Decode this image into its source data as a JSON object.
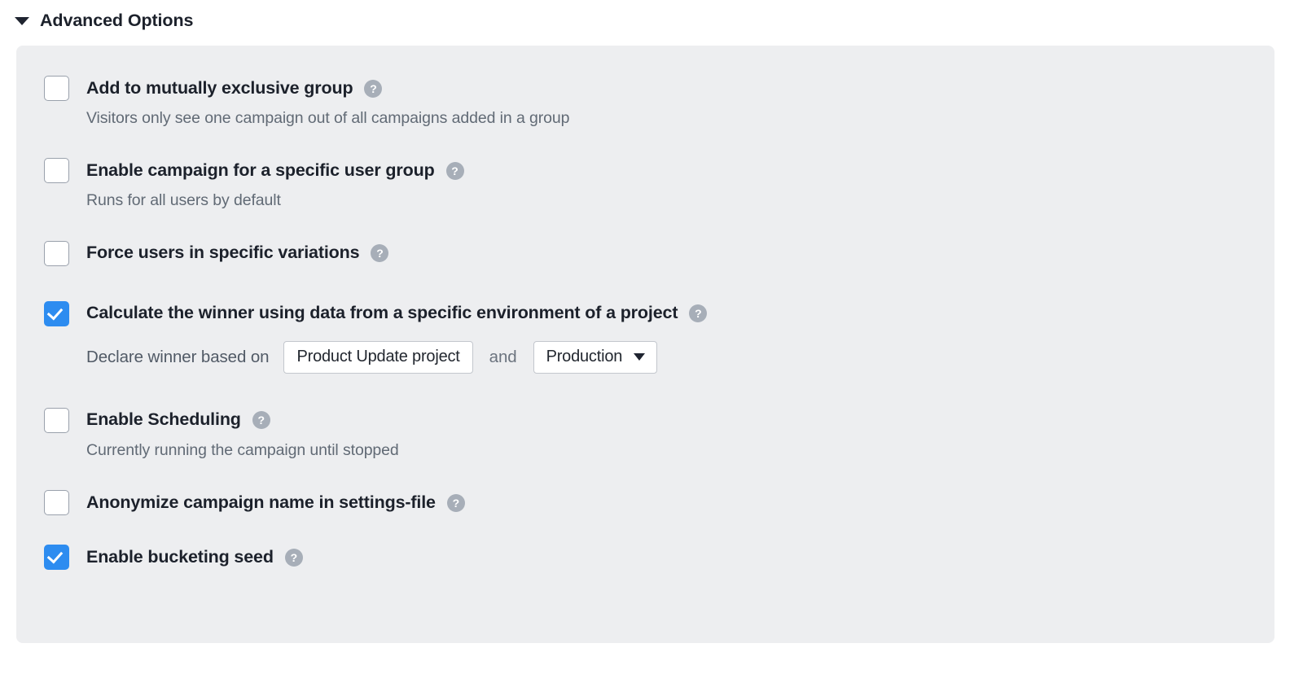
{
  "header": {
    "title": "Advanced Options",
    "disclosure_state": "expanded",
    "disclosure_icon": "triangle-down-icon"
  },
  "colors": {
    "panel_background": "#edeef0",
    "page_background": "#ffffff",
    "checkbox_checked": "#2d8cf0",
    "checkbox_border": "#9aa1ac",
    "label_text": "#1c212b",
    "description_text": "#616a75",
    "help_icon_background": "#a7aeb8",
    "field_border": "#c3c7cd"
  },
  "options": [
    {
      "id": "mutually-exclusive-group",
      "label": "Add to mutually exclusive group",
      "checked": false,
      "help_icon": "help-circle-icon",
      "description": "Visitors only see one campaign out of all campaigns added in a group"
    },
    {
      "id": "specific-user-group",
      "label": "Enable campaign for a specific user group",
      "checked": false,
      "help_icon": "help-circle-icon",
      "description": "Runs for all users by default"
    },
    {
      "id": "force-users-variations",
      "label": "Force users in specific variations",
      "checked": false,
      "help_icon": "help-circle-icon",
      "description": null
    },
    {
      "id": "calculate-winner-environment",
      "label": "Calculate the winner using data from a specific environment of a project",
      "checked": true,
      "help_icon": "help-circle-icon",
      "description": null,
      "inline_controls": {
        "prefix_text": "Declare winner based on",
        "project_field_value": "Product Update project",
        "conjunction_text": "and",
        "environment_select_value": "Production",
        "environment_select_icon": "caret-down-icon"
      }
    },
    {
      "id": "enable-scheduling",
      "label": "Enable Scheduling",
      "checked": false,
      "help_icon": "help-circle-icon",
      "description": "Currently running the campaign until stopped"
    },
    {
      "id": "anonymize-campaign-name",
      "label": "Anonymize campaign name in settings-file",
      "checked": false,
      "help_icon": "help-circle-icon",
      "description": null
    },
    {
      "id": "enable-bucketing-seed",
      "label": "Enable bucketing seed",
      "checked": true,
      "help_icon": "help-circle-icon",
      "description": null
    }
  ],
  "help_glyph": "?"
}
